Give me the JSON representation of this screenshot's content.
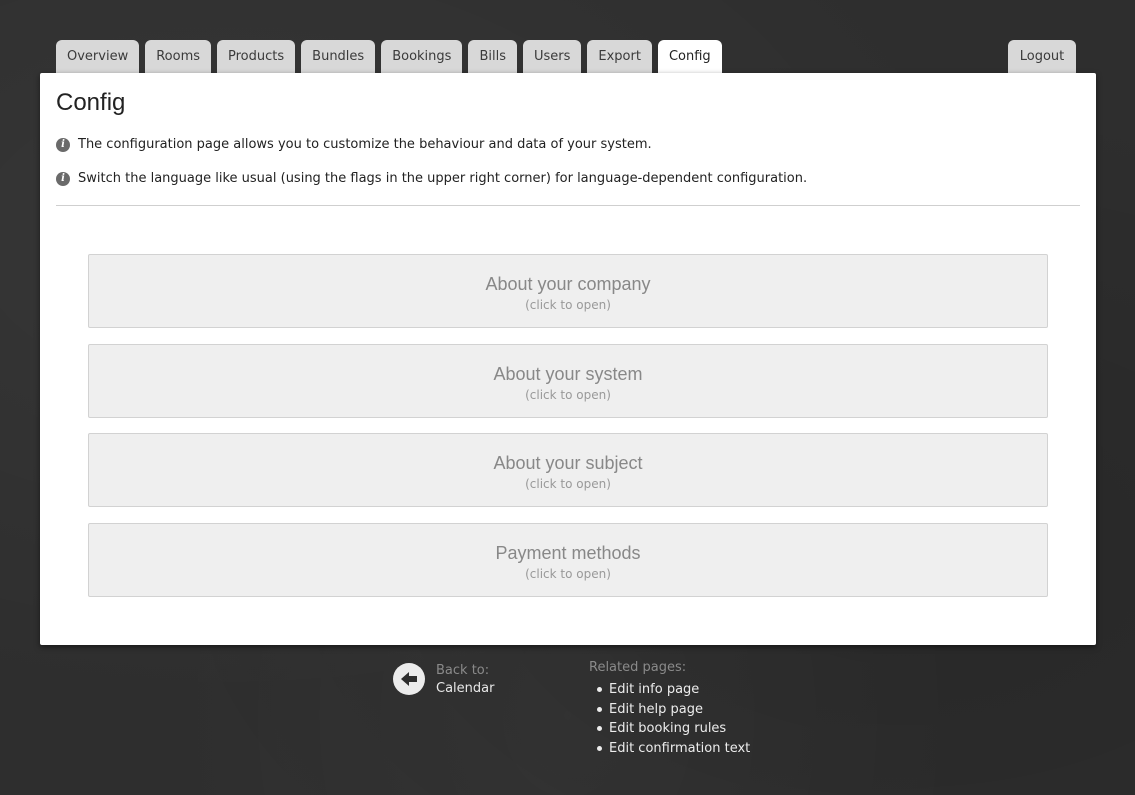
{
  "nav": {
    "tabs": [
      {
        "label": "Overview"
      },
      {
        "label": "Rooms"
      },
      {
        "label": "Products"
      },
      {
        "label": "Bundles"
      },
      {
        "label": "Bookings"
      },
      {
        "label": "Bills"
      },
      {
        "label": "Users"
      },
      {
        "label": "Export"
      },
      {
        "label": "Config"
      }
    ],
    "active_tab": "Config",
    "logout_label": "Logout"
  },
  "page": {
    "title": "Config",
    "info": [
      "The configuration page allows you to customize the behaviour and data of your system.",
      "Switch the language like usual (using the flags in the upper right corner) for language-dependent configuration."
    ],
    "info_icon": "info-icon"
  },
  "sections": [
    {
      "title": "About your company",
      "hint": "(click to open)"
    },
    {
      "title": "About your system",
      "hint": "(click to open)"
    },
    {
      "title": "About your subject",
      "hint": "(click to open)"
    },
    {
      "title": "Payment methods",
      "hint": "(click to open)"
    }
  ],
  "footer": {
    "back_label": "Back to:",
    "back_target": "Calendar",
    "back_icon": "arrow-left-icon",
    "related_heading": "Related pages:",
    "related_links": [
      "Edit info page",
      "Edit help page",
      "Edit booking rules",
      "Edit confirmation text"
    ]
  },
  "colors": {
    "background": "#2e2e2e",
    "panel": "#ffffff",
    "tab": "#d8d8d8",
    "section_box": "#efefef",
    "section_text": "#888888"
  }
}
